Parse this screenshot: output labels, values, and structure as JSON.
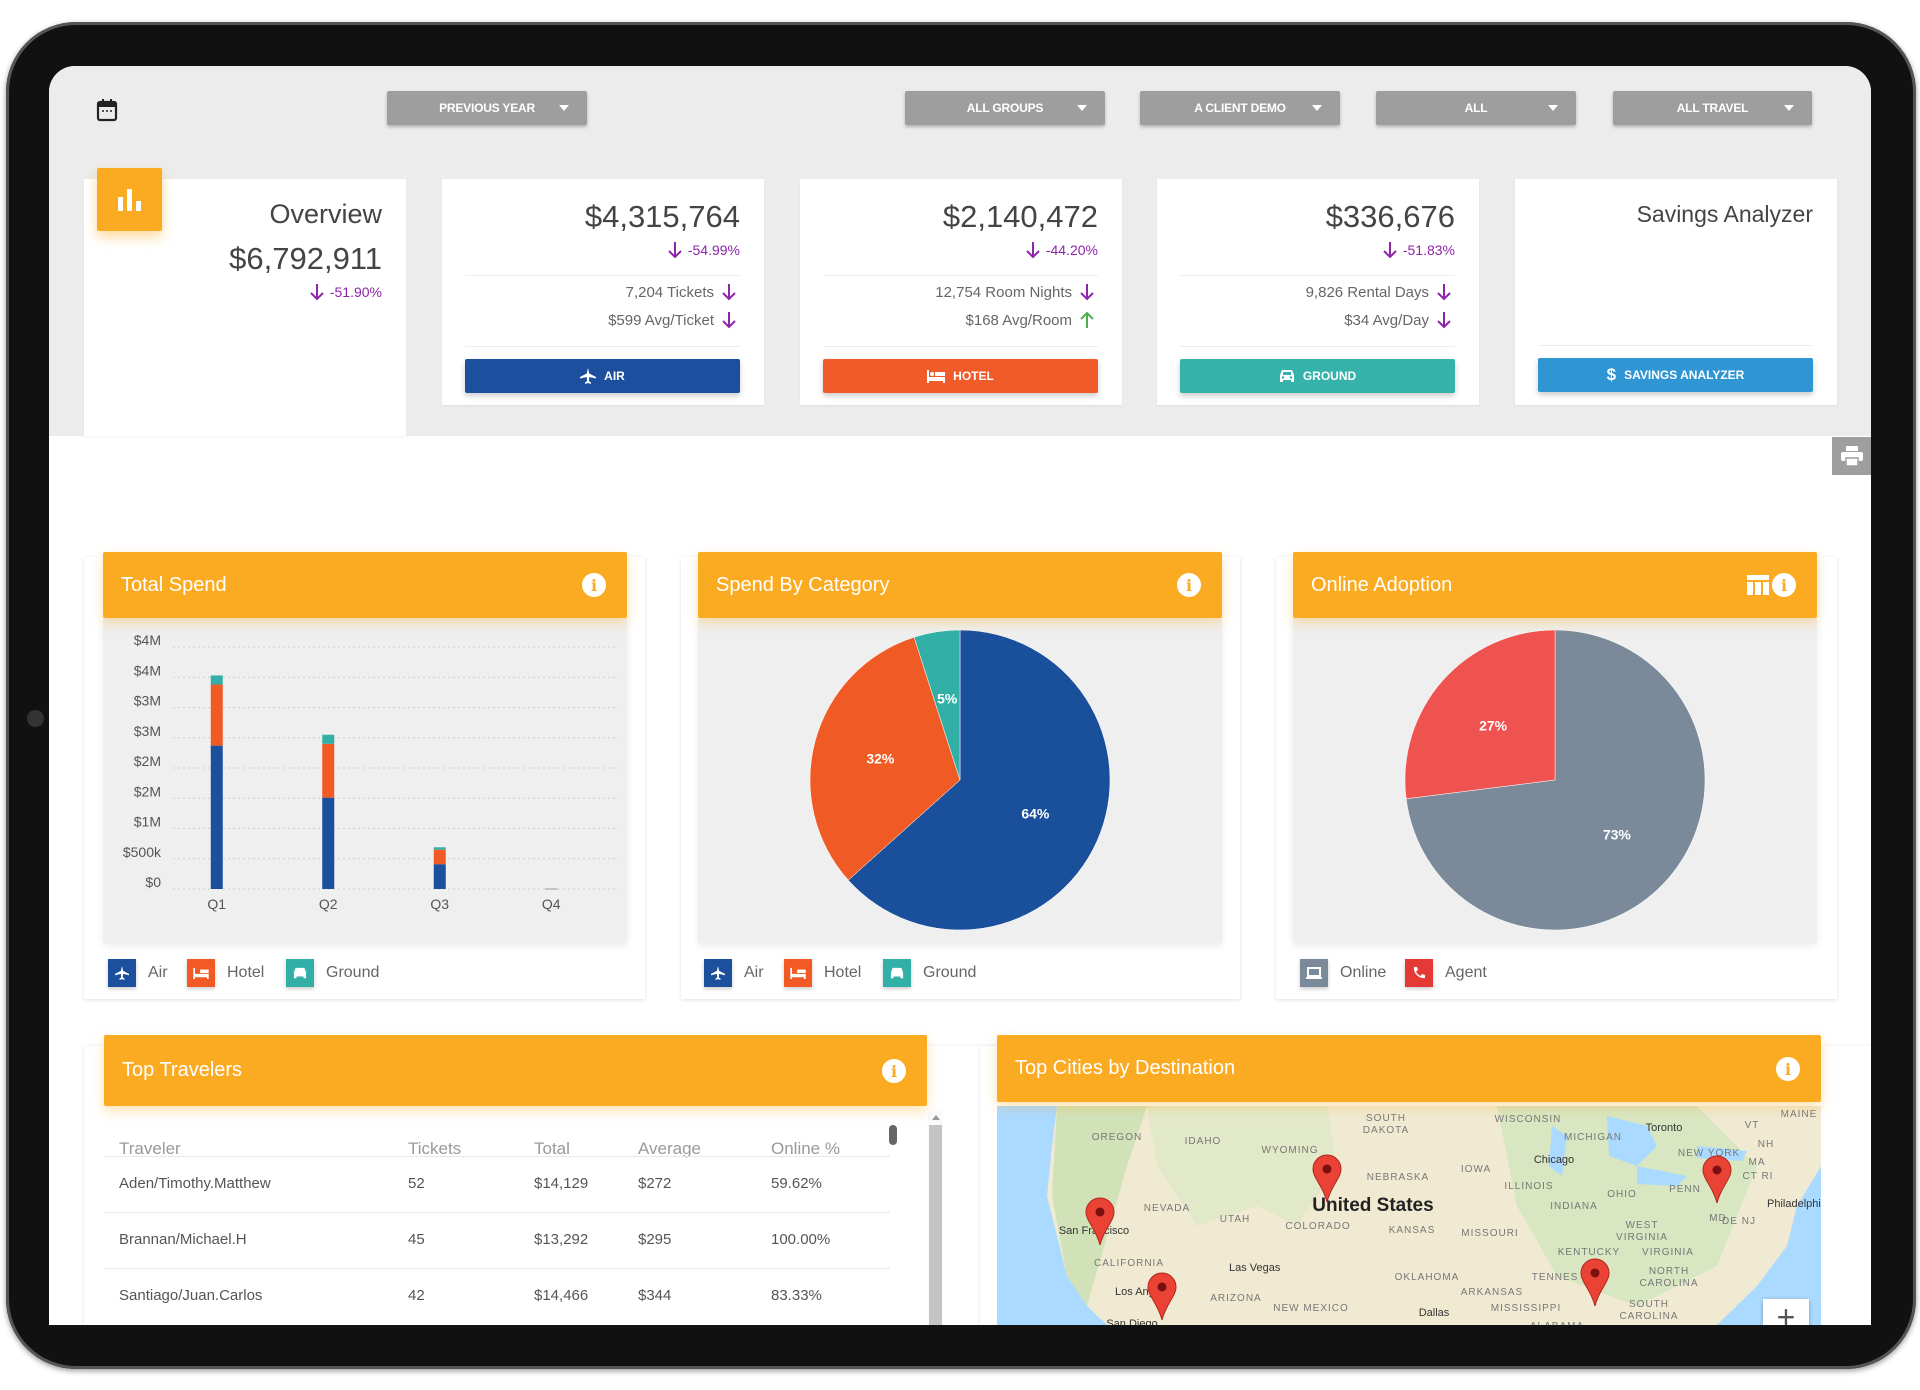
{
  "filters": [
    {
      "label": "PREVIOUS YEAR"
    },
    {
      "label": "ALL GROUPS"
    },
    {
      "label": "A CLIENT DEMO"
    },
    {
      "label": "ALL"
    },
    {
      "label": "ALL TRAVEL"
    }
  ],
  "overview": {
    "title": "Overview",
    "total": "$6,792,911",
    "change": "-51.90%"
  },
  "cards": {
    "air": {
      "total": "$4,315,764",
      "change": "-54.99%",
      "line1": "7,204 Tickets",
      "line2": "$599 Avg/Ticket",
      "button": "AIR",
      "color": "#1c509e"
    },
    "hotel": {
      "total": "$2,140,472",
      "change": "-44.20%",
      "line1": "12,754 Room Nights",
      "line2": "$168 Avg/Room",
      "button": "HOTEL",
      "color": "#f15a29"
    },
    "ground": {
      "total": "$336,676",
      "change": "-51.83%",
      "line1": "9,826 Rental Days",
      "line2": "$34 Avg/Day",
      "button": "GROUND",
      "color": "#35b2aa"
    },
    "savings": {
      "title": "Savings Analyzer",
      "button": "SAVINGS ANALYZER",
      "color": "#2f95d3"
    }
  },
  "colors": {
    "accent": "#fbab22",
    "down": "#8e24aa",
    "up": "#4caf50",
    "air": "#1c4f9c",
    "hotel": "#f15a24",
    "ground": "#32b0a8",
    "online": "#7a8a9a",
    "agent": "#ef5350"
  },
  "widgets": {
    "total_spend": {
      "title": "Total Spend"
    },
    "spend_by_category": {
      "title": "Spend By Category"
    },
    "online_adoption": {
      "title": "Online Adoption"
    },
    "top_travelers": {
      "title": "Top Travelers"
    },
    "top_cities": {
      "title": "Top Cities by Destination"
    }
  },
  "chart_data": [
    {
      "type": "bar",
      "stacked": true,
      "title": "Total Spend",
      "categories": [
        "Q1",
        "Q2",
        "Q3",
        "Q4"
      ],
      "y_ticks": [
        "$0",
        "$500k",
        "$1M",
        "$2M",
        "$2M",
        "$3M",
        "$3M",
        "$4M",
        "$4M"
      ],
      "ylim": [
        0,
        4000000
      ],
      "grid": true,
      "legend": "bottom-left",
      "series": [
        {
          "name": "Air",
          "color": "#1c4f9c",
          "values": [
            2370000,
            1510000,
            410000,
            0
          ]
        },
        {
          "name": "Hotel",
          "color": "#f15a24",
          "values": [
            1010000,
            890000,
            240000,
            0
          ]
        },
        {
          "name": "Ground",
          "color": "#32b0a8",
          "values": [
            150000,
            150000,
            40000,
            0
          ]
        }
      ]
    },
    {
      "type": "pie",
      "title": "Spend By Category",
      "legend": "bottom-left",
      "slices": [
        {
          "name": "Air",
          "value": 64,
          "label": "64%",
          "color": "#1a4f9c"
        },
        {
          "name": "Hotel",
          "value": 32,
          "label": "32%",
          "color": "#f05a24"
        },
        {
          "name": "Ground",
          "value": 5,
          "label": "5%",
          "color": "#32b0a8"
        }
      ]
    },
    {
      "type": "pie",
      "title": "Online Adoption",
      "legend": "bottom-left",
      "slices": [
        {
          "name": "Online",
          "value": 73,
          "label": "73%",
          "color": "#7a8a9a"
        },
        {
          "name": "Agent",
          "value": 27,
          "label": "27%",
          "color": "#ef5350"
        }
      ]
    }
  ],
  "travelers": {
    "columns": [
      "Traveler",
      "Tickets",
      "Total",
      "Average",
      "Online %"
    ],
    "rows": [
      [
        "Aden/Timothy.Matthew",
        "52",
        "$14,129",
        "$272",
        "59.62%"
      ],
      [
        "Brannan/Michael.H",
        "45",
        "$13,292",
        "$295",
        "100.00%"
      ],
      [
        "Santiago/Juan.Carlos",
        "42",
        "$14,466",
        "$344",
        "83.33%"
      ]
    ]
  },
  "map": {
    "labels": [
      "OREGON",
      "IDAHO",
      "WYOMING",
      "SOUTH",
      "DAKOTA",
      "NEBRASKA",
      "WISCONSIN",
      "MICHIGAN",
      "Toronto",
      "MAINE",
      "VT",
      "NH",
      "NEW YORK",
      "MA",
      "CT RI",
      "Chicago",
      "IOWA",
      "ILLINOIS",
      "OHIO",
      "PENN",
      "INDIANA",
      "Philadelphia",
      "United States",
      "NEVADA",
      "UTAH",
      "COLORADO",
      "KANSAS",
      "MISSOURI",
      "WEST",
      "VIRGINIA",
      "MD",
      "DE NJ",
      "San Francisco",
      "KENTUCKY",
      "VIRGINIA",
      "CALIFORNIA",
      "Las Vegas",
      "OKLAHOMA",
      "TENNES",
      "NORTH",
      "CAROLINA",
      "ARKANSAS",
      "ARIZONA",
      "NEW MEXICO",
      "Los Angeles",
      "Dallas",
      "MISSISSIPPI",
      "SOUTH",
      "CAROLINA",
      "San Diego",
      "ALABAMA"
    ],
    "zoom_in": "+"
  }
}
